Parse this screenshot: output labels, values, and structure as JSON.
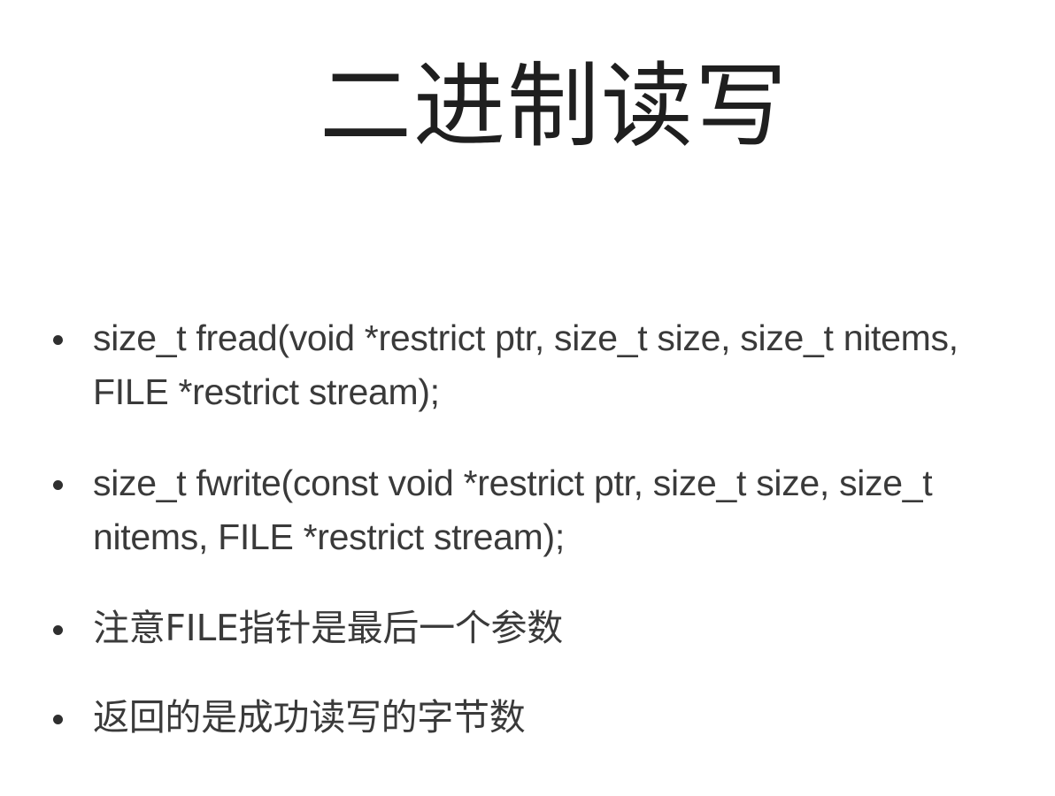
{
  "slide": {
    "title": "二进制读写",
    "bullets": [
      {
        "text": "size_t fread(void *restrict ptr, size_t size, size_t nitems, FILE *restrict stream);"
      },
      {
        "text": "size_t fwrite(const void *restrict ptr, size_t size, size_t nitems, FILE *restrict stream);"
      },
      {
        "text": "注意FILE指针是最后一个参数"
      },
      {
        "text": "返回的是成功读写的字节数"
      }
    ]
  }
}
